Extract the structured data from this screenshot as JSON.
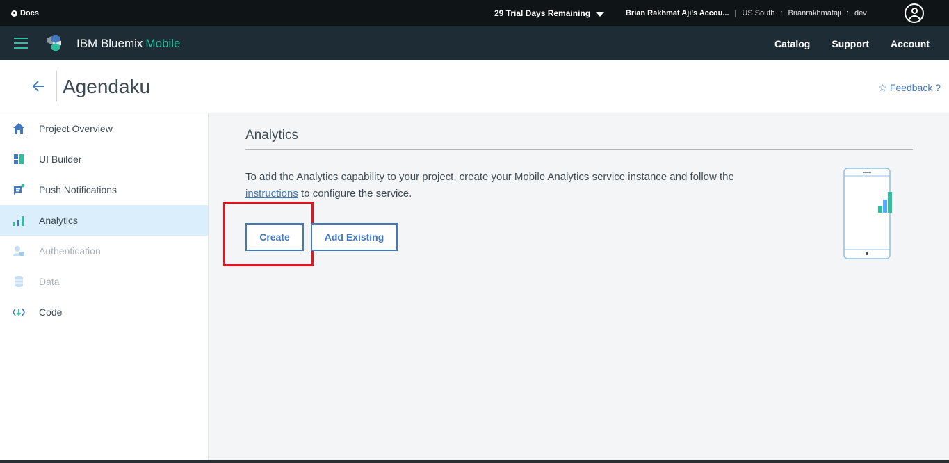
{
  "topbar": {
    "docs_label": "Docs",
    "trial_label": "29 Trial Days Remaining",
    "account_name": "Brian Rakhmat Aji's Accou...",
    "region": "US South",
    "org": "Brianrakhmataji",
    "space": "dev",
    "separator": ":",
    "divider": "|"
  },
  "brand": {
    "name": "IBM Bluemix",
    "product": "Mobile",
    "accent_color": "#2fbfa0"
  },
  "nav": {
    "catalog": "Catalog",
    "support": "Support",
    "account": "Account"
  },
  "page": {
    "title": "Agendaku",
    "feedback": "☆ Feedback ?"
  },
  "sidebar": {
    "items": [
      {
        "label": "Project Overview",
        "icon": "home-icon"
      },
      {
        "label": "UI Builder",
        "icon": "ui-builder-icon"
      },
      {
        "label": "Push Notifications",
        "icon": "push-notifications-icon"
      },
      {
        "label": "Analytics",
        "icon": "analytics-icon",
        "active": true
      },
      {
        "label": "Authentication",
        "icon": "authentication-icon",
        "disabled": true
      },
      {
        "label": "Data",
        "icon": "database-icon",
        "disabled": true
      },
      {
        "label": "Code",
        "icon": "code-icon"
      }
    ]
  },
  "main": {
    "heading": "Analytics",
    "description_before": "To add the Analytics capability to your project, create your Mobile Analytics service instance and follow the ",
    "description_link": "instructions",
    "description_after": " to configure the service.",
    "create_label": "Create",
    "add_existing_label": "Add Existing",
    "link_color": "#4178be",
    "highlight_color": "#e4141f"
  }
}
